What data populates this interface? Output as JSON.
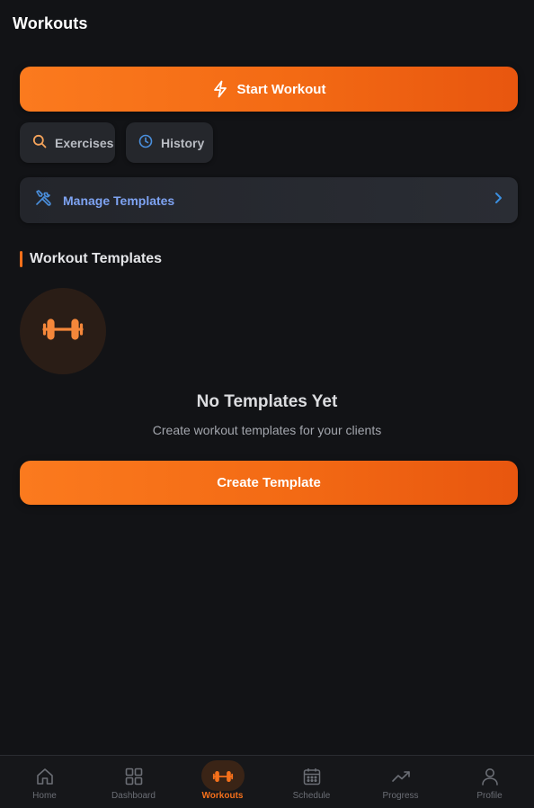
{
  "header": {
    "title": "Workouts"
  },
  "actions": {
    "start_workout_label": "Start Workout",
    "exercises_label": "Exercises",
    "history_label": "History",
    "manage_templates_label": "Manage Templates"
  },
  "templates_section": {
    "title": "Workout Templates",
    "empty_title": "No Templates Yet",
    "empty_subtitle": "Create workout templates for your clients",
    "create_button_label": "Create Template"
  },
  "bottom_nav": {
    "items": [
      {
        "label": "Home",
        "icon": "home-icon",
        "active": false
      },
      {
        "label": "Dashboard",
        "icon": "dashboard-grid-icon",
        "active": false
      },
      {
        "label": "Workouts",
        "icon": "dumbbell-icon",
        "active": true
      },
      {
        "label": "Schedule",
        "icon": "calendar-icon",
        "active": false
      },
      {
        "label": "Progress",
        "icon": "trending-up-icon",
        "active": false
      },
      {
        "label": "Profile",
        "icon": "user-icon",
        "active": false
      }
    ]
  },
  "colors": {
    "background": "#121316",
    "accent": "#f56f1a",
    "card": "#25272c",
    "link_blue": "#7ea3f2",
    "chevron_blue": "#3b8fe0"
  },
  "icons": {
    "start_workout": "lightning-bolt-icon",
    "exercises": "search-icon",
    "history": "clock-icon",
    "manage_templates": "tools-icon",
    "manage_chevron": "chevron-right-icon",
    "empty_state": "dumbbell-icon"
  }
}
